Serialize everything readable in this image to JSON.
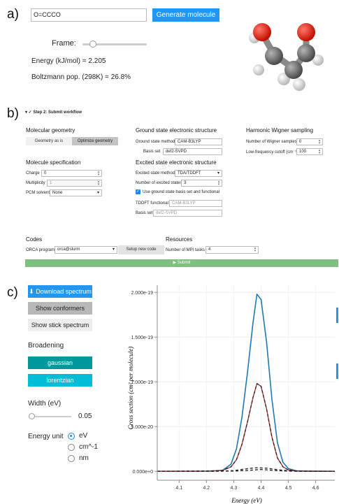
{
  "panel_a": {
    "label": "a)",
    "smiles_value": "O=CCCO",
    "generate_button": "Generate molecule",
    "frame_label": "Frame:",
    "frame_value": 0.2,
    "energy_label": "Energy (kJ/mol) =",
    "energy_value": "2.205",
    "boltz_label": "Boltzmann pop. (298K) =",
    "boltz_value": "26.8%",
    "colors": {
      "accent": "#2196f3",
      "oxygen": "#e8200e",
      "carbon": "#7a7a7a",
      "hydrogen": "#e6e6e6"
    }
  },
  "panel_b": {
    "label": "b)",
    "step_title": "▾ ✓ Step 2: Submit workflow",
    "mol_geom_title": "Molecular geometry",
    "geom_as_is": "Geometry as is",
    "optimize_geom": "Optimize geometry",
    "mol_spec_title": "Molecule specification",
    "charge_label": "Charge",
    "charge_value": "0",
    "mult_label": "Multiplicity",
    "mult_value": "1",
    "pcm_label": "PCM solvent",
    "pcm_value": "None",
    "gs_title": "Ground state electronic structure",
    "gs_method_label": "Ground state method",
    "gs_method_value": "CAM-B3LYP",
    "gs_basis_label": "Basis set",
    "gs_basis_value": "def2-SVPD",
    "es_title": "Excited state electronic structure",
    "es_method_label": "Excited state method",
    "es_method_value": "TDA/TDDFT",
    "n_states_label": "Number of excited states",
    "n_states_value": "3",
    "use_gs_label": "Use ground state basis set and functional",
    "tddft_label": "TDDFT functional",
    "tddft_placeholder": "CAM-B3LYP",
    "es_basis_label": "Basis set",
    "es_basis_placeholder": "def2-SVPD",
    "wigner_title": "Harmonic Wigner sampling",
    "n_wigner_label": "Number of Wigner samples",
    "n_wigner_value": "0",
    "cutoff_label": "Low-frequency cutoff (cm⁻¹)",
    "cutoff_value": "100",
    "codes_title": "Codes",
    "orca_label": "ORCA program",
    "orca_value": "orca@slurm",
    "setup_code": "Setup new code",
    "resources_title": "Resources",
    "mpi_label": "Number of MPI tasks",
    "mpi_value": "4",
    "submit": "▶ Submit"
  },
  "panel_c": {
    "label": "c)",
    "download": "Download spectrum",
    "show_conformers": "Show conformers",
    "show_stick": "Show stick spectrum",
    "broadening_title": "Broadening",
    "gaussian": "gaussian",
    "lorentzian": "lorentzian",
    "width_label": "Width (eV)",
    "width_value": "0.05",
    "energy_unit_label": "Energy unit",
    "units": [
      "eV",
      "cm^-1",
      "nm"
    ],
    "selected_unit": "eV"
  },
  "chart_data": {
    "type": "line",
    "xlabel": "Energy (eV)",
    "ylabel": "Cross section (cm² per molecule)",
    "xlim": [
      4.02,
      4.67
    ],
    "ylim": [
      -1e-20,
      2.08e-19
    ],
    "xticks": [
      "4.1",
      "4.2",
      "4.3",
      "4.4",
      "4.5",
      "4.6"
    ],
    "xtick_values": [
      4.1,
      4.2,
      4.3,
      4.4,
      4.5,
      4.6
    ],
    "yticks": [
      "0.000e+0",
      "5.000e-20",
      "1.000e-19",
      "1.500e-19",
      "2.000e-19"
    ],
    "ytick_values": [
      0,
      5e-20,
      1e-19,
      1.5e-19,
      2e-19
    ],
    "series": [
      {
        "color": "#1f77b4",
        "style": "solid",
        "x": [
          4.02,
          4.15,
          4.22,
          4.26,
          4.29,
          4.31,
          4.33,
          4.35,
          4.37,
          4.385,
          4.4,
          4.42,
          4.44,
          4.46,
          4.48,
          4.5,
          4.53,
          4.58,
          4.67
        ],
        "y": [
          0,
          0,
          2e-22,
          1.2e-21,
          8e-21,
          2.5e-20,
          6e-20,
          1.1e-19,
          1.65e-19,
          1.98e-19,
          1.92e-19,
          1.45e-19,
          8e-20,
          3.2e-20,
          1e-20,
          3e-21,
          5e-22,
          0,
          0
        ]
      },
      {
        "color": "#c62828",
        "style": "solid",
        "x": [
          4.02,
          4.2,
          4.26,
          4.29,
          4.31,
          4.33,
          4.35,
          4.37,
          4.385,
          4.4,
          4.42,
          4.44,
          4.46,
          4.48,
          4.5,
          4.53,
          4.67
        ],
        "y": [
          0,
          2e-22,
          1e-21,
          5e-21,
          1.3e-20,
          3e-20,
          5.5e-20,
          8.2e-20,
          9.8e-20,
          9.5e-20,
          7e-20,
          3.8e-20,
          1.5e-20,
          5e-21,
          1.5e-21,
          3e-22,
          0
        ]
      },
      {
        "color": "#222222",
        "style": "dashed",
        "x": [
          4.02,
          4.2,
          4.26,
          4.29,
          4.31,
          4.33,
          4.35,
          4.37,
          4.385,
          4.4,
          4.42,
          4.44,
          4.46,
          4.48,
          4.5,
          4.53,
          4.67
        ],
        "y": [
          0,
          2e-22,
          1e-21,
          5e-21,
          1.3e-20,
          3e-20,
          5.5e-20,
          8.2e-20,
          9.8e-20,
          9.5e-20,
          7e-20,
          3.8e-20,
          1.5e-20,
          5e-21,
          1.5e-21,
          3e-22,
          0
        ]
      },
      {
        "color": "#222222",
        "style": "dashed",
        "x": [
          4.02,
          4.25,
          4.3,
          4.34,
          4.38,
          4.42,
          4.46,
          4.5,
          4.55,
          4.67
        ],
        "y": [
          0,
          1e-22,
          8e-22,
          2.5e-21,
          4e-21,
          3.5e-21,
          1.8e-21,
          6e-22,
          1e-22,
          0
        ]
      },
      {
        "color": "#222222",
        "style": "dashed",
        "x": [
          4.02,
          4.3,
          4.36,
          4.4,
          4.44,
          4.48,
          4.53,
          4.67
        ],
        "y": [
          0,
          2e-22,
          1.2e-21,
          2e-21,
          1.2e-21,
          4e-22,
          0,
          0
        ]
      }
    ]
  }
}
